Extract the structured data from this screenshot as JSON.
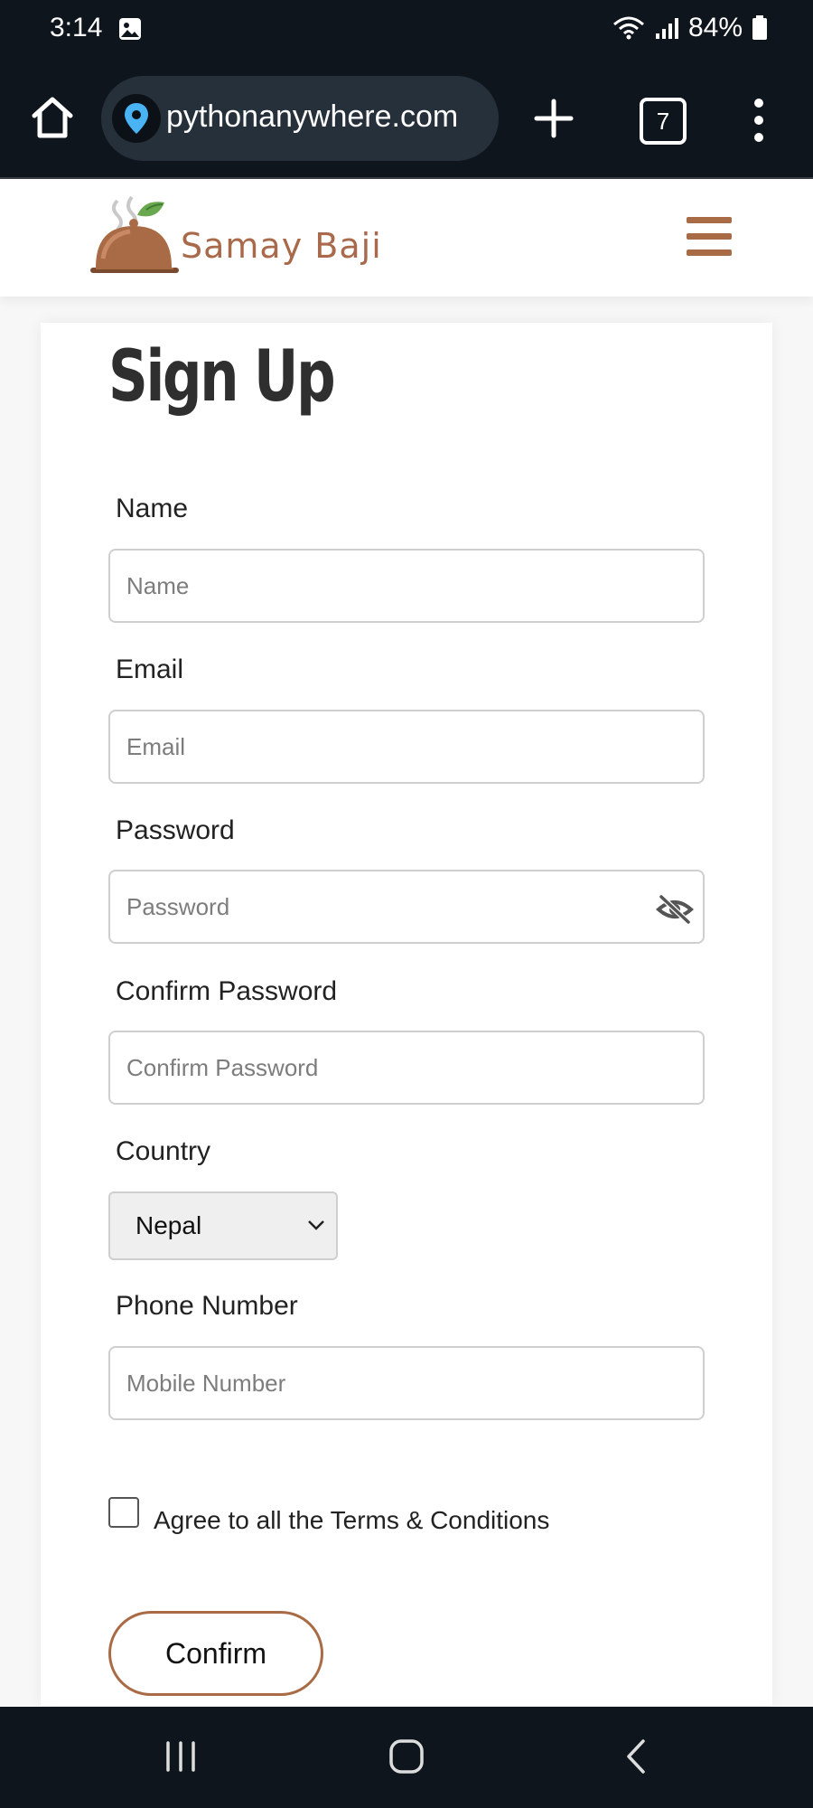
{
  "status_bar": {
    "time": "3:14",
    "battery": "84%"
  },
  "browser": {
    "url": "pythonanywhere.com",
    "tab_count": "7"
  },
  "site": {
    "brand": "Samay Baji"
  },
  "form": {
    "title": "Sign Up",
    "name_label": "Name",
    "name_placeholder": "Name",
    "email_label": "Email",
    "email_placeholder": "Email",
    "password_label": "Password",
    "password_placeholder": "Password",
    "confirm_password_label": "Confirm Password",
    "confirm_password_placeholder": "Confirm Password",
    "country_label": "Country",
    "country_value": "Nepal",
    "phone_label": "Phone Number",
    "phone_placeholder": "Mobile Number",
    "agree_prefix": "Agree to all the ",
    "agree_link": "Terms & Conditions",
    "confirm_label": "Confirm"
  },
  "colors": {
    "brand": "#a86b45",
    "system_bar": "#0f151d"
  }
}
